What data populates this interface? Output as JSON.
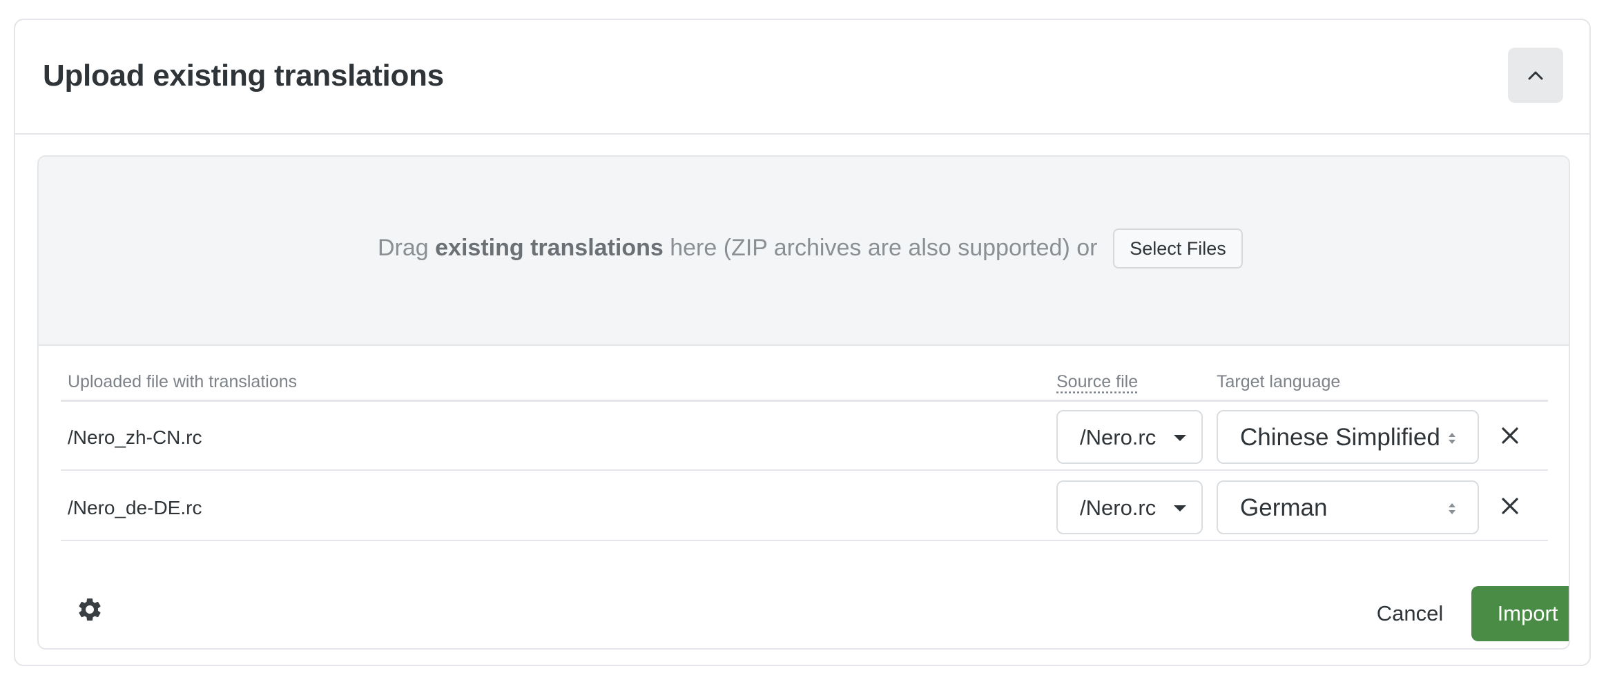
{
  "panel": {
    "title": "Upload existing translations",
    "collapse_icon": "chevron-up-icon"
  },
  "dropzone": {
    "text_before": "Drag ",
    "text_strong": "existing translations",
    "text_after": " here (ZIP archives are also supported) or",
    "select_files_label": "Select Files"
  },
  "table": {
    "columns": {
      "file": "Uploaded file with translations",
      "source": "Source file",
      "target": "Target language"
    },
    "rows": [
      {
        "file": "/Nero_zh-CN.rc",
        "source": "/Nero.rc",
        "target": "Chinese Simplified"
      },
      {
        "file": "/Nero_de-DE.rc",
        "source": "/Nero.rc",
        "target": "German"
      }
    ]
  },
  "footer": {
    "settings_icon": "gear-icon",
    "cancel_label": "Cancel",
    "import_label": "Import"
  },
  "colors": {
    "accent": "#4a8c46",
    "border": "#e3e5e8",
    "dropzone_bg": "#f4f5f7"
  }
}
